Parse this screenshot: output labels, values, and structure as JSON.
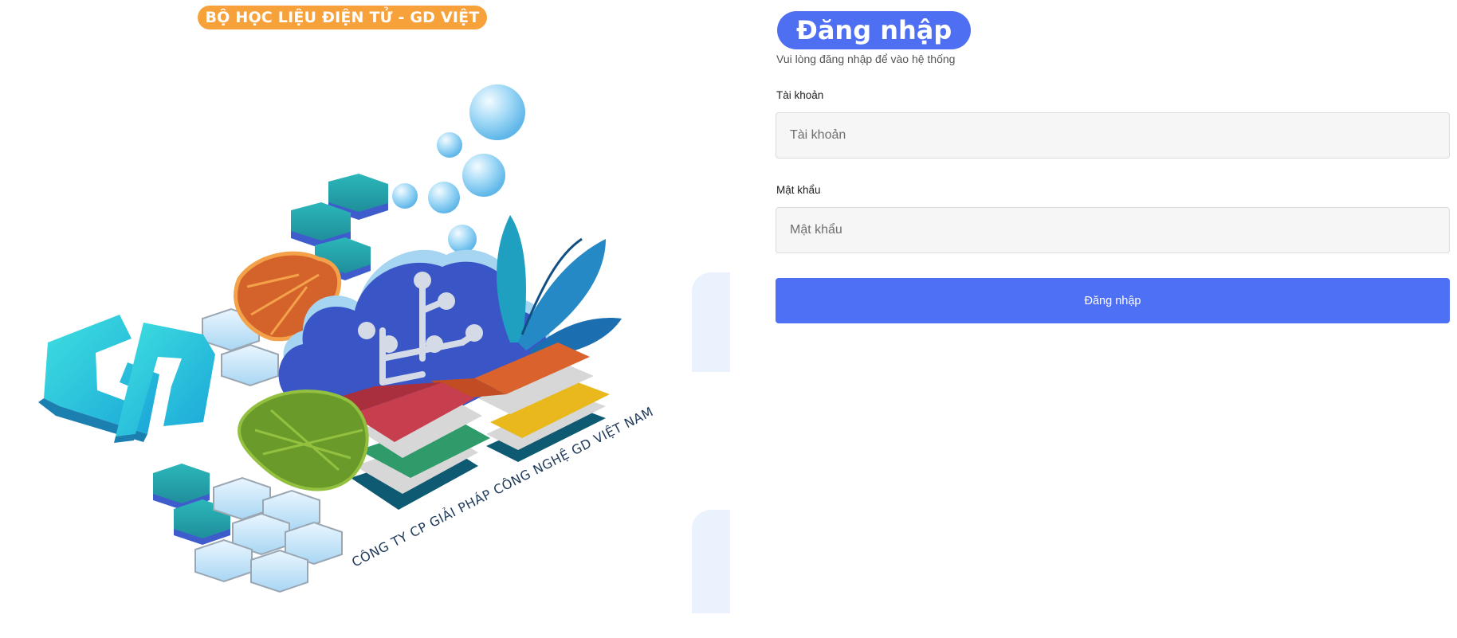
{
  "illustration": {
    "banner_text": "BỘ HỌC LIỆU ĐIỆN TỬ - GD VIỆT NAM",
    "company_text": "CÔNG TY CP GIẢI PHÁP CÔNG NGHỆ GD VIỆT NAM",
    "logo_letters": "GD"
  },
  "login": {
    "title": "Đăng nhập",
    "subtitle": "Vui lòng đăng nhập để vào hệ thống",
    "username_label": "Tài khoản",
    "username_placeholder": "Tài khoản",
    "username_value": "",
    "password_label": "Mật khẩu",
    "password_placeholder": "Mật khẩu",
    "password_value": "",
    "submit_label": "Đăng nhập"
  },
  "colors": {
    "accent": "#4e70f5",
    "banner": "#f7a13a",
    "input_bg": "#f6f6f6"
  }
}
